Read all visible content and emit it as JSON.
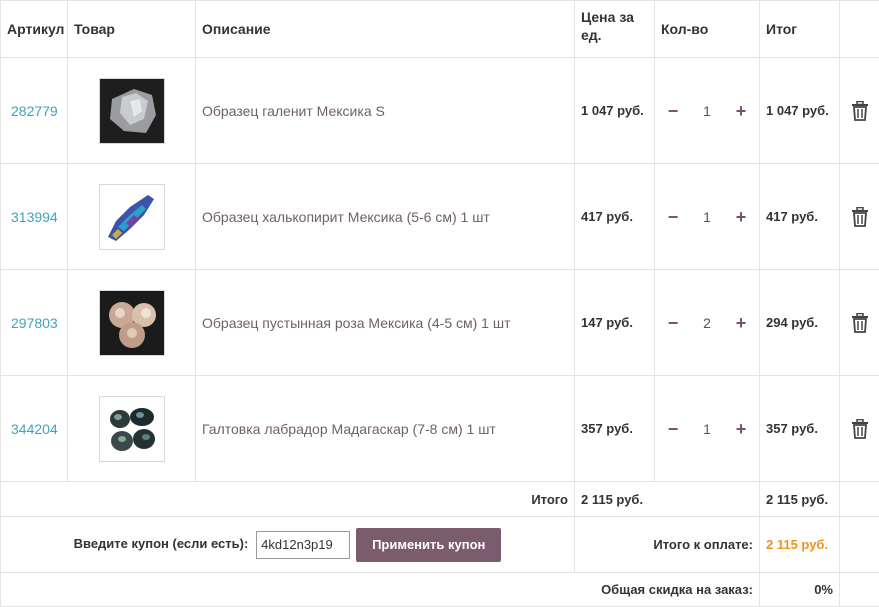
{
  "header": {
    "sku": "Артикул",
    "product": "Товар",
    "description": "Описание",
    "unit_price": "Цена за ед.",
    "qty": "Кол-во",
    "total": "Итог"
  },
  "items": [
    {
      "sku": "282779",
      "description": "Образец галенит Мексика S",
      "price": "1 047 руб.",
      "qty": "1",
      "total": "1 047 руб.",
      "image": "galena-thumbnail"
    },
    {
      "sku": "313994",
      "description": "Образец халькопирит Мексика (5-6 см) 1 шт",
      "price": "417 руб.",
      "qty": "1",
      "total": "417 руб.",
      "image": "chalcopyrite-thumbnail"
    },
    {
      "sku": "297803",
      "description": "Образец пустынная роза Мексика (4-5 см) 1 шт",
      "price": "147 руб.",
      "qty": "2",
      "total": "294 руб.",
      "image": "desert-rose-thumbnail"
    },
    {
      "sku": "344204",
      "description": "Галтовка лабрадор Мадагаскар (7-8 см) 1 шт",
      "price": "357 руб.",
      "qty": "1",
      "total": "357 руб.",
      "image": "labradorite-thumbnail"
    }
  ],
  "qty_controls": {
    "minus": "−",
    "plus": "+"
  },
  "summary": {
    "subtotal_label": "Итого",
    "subtotal_price": "2 115 руб.",
    "subtotal_total": "2 115 руб.",
    "coupon_label": "Введите купон (если есть):",
    "coupon_value": "4kd12n3p19",
    "coupon_button": "Применить купон",
    "pay_label": "Итого к оплате:",
    "pay_value": "2 115 руб.",
    "discount_label": "Общая скидка на заказ:",
    "discount_value": "0%"
  },
  "colors": {
    "link": "#3fa3c0",
    "accent": "#7b4f6f",
    "button": "#7b5c6c",
    "pay_total": "#f0921e"
  }
}
